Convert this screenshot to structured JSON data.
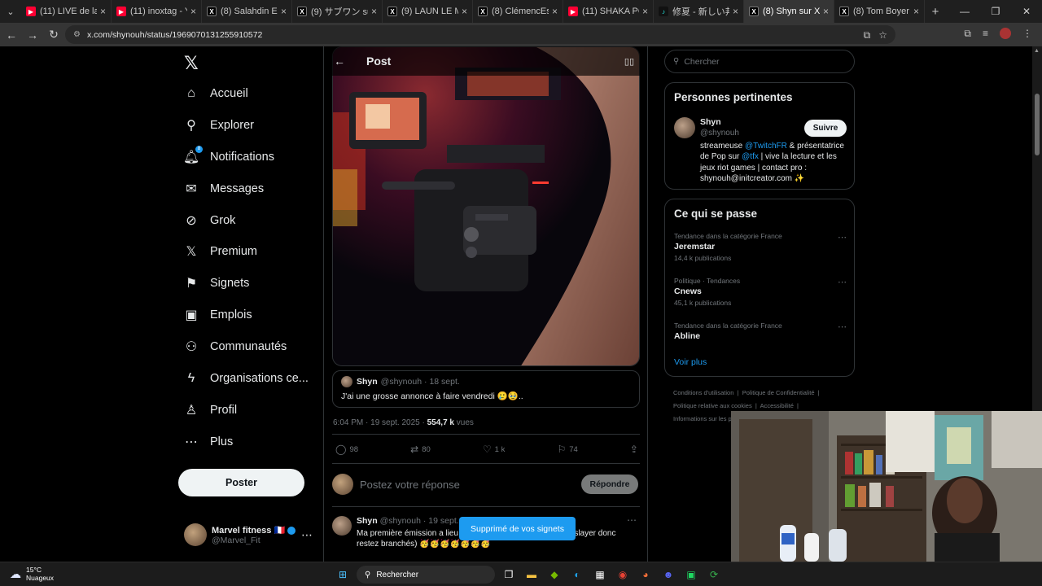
{
  "browser": {
    "tabs": [
      {
        "title": "(11) LIVE de la PA",
        "icon": "youtube-icon",
        "active": false
      },
      {
        "title": "(11) inoxtag - You",
        "icon": "youtube-icon",
        "active": false
      },
      {
        "title": "(8) Salahdin E. su",
        "icon": "x-icon",
        "active": false
      },
      {
        "title": "(9) サブワン sur X :",
        "icon": "x-icon",
        "active": false
      },
      {
        "title": "(9) LAUN LE MAL",
        "icon": "x-icon",
        "active": false
      },
      {
        "title": "(8) ClémencEspoi",
        "icon": "x-icon",
        "active": false
      },
      {
        "title": "(11) SHAKA PONK",
        "icon": "youtube-icon",
        "active": false
      },
      {
        "title": "修夏 - 新しい邦ロッ",
        "icon": "tiktok-icon",
        "active": false
      },
      {
        "title": "(8) Shyn sur X : \"J'",
        "icon": "x-icon",
        "active": true
      },
      {
        "title": "(8) Tom Boyer sur",
        "icon": "x-icon",
        "active": false
      }
    ],
    "url": "x.com/shynouh/status/1969070131255910572"
  },
  "nav": {
    "items": [
      {
        "label": "Accueil",
        "icon": "home-icon"
      },
      {
        "label": "Explorer",
        "icon": "search-icon"
      },
      {
        "label": "Notifications",
        "icon": "bell-icon",
        "badge": "8"
      },
      {
        "label": "Messages",
        "icon": "envelope-icon"
      },
      {
        "label": "Grok",
        "icon": "grok-icon"
      },
      {
        "label": "Premium",
        "icon": "x-icon"
      },
      {
        "label": "Signets",
        "icon": "bookmark-icon"
      },
      {
        "label": "Emplois",
        "icon": "briefcase-icon"
      },
      {
        "label": "Communautés",
        "icon": "people-icon"
      },
      {
        "label": "Organisations ce...",
        "icon": "lightning-icon"
      },
      {
        "label": "Profil",
        "icon": "person-icon"
      },
      {
        "label": "Plus",
        "icon": "more-circle-icon"
      }
    ],
    "post_label": "Poster",
    "account": {
      "name": "Marvel fitness",
      "flag": "🇫🇷",
      "handle": "@Marvel_Fit"
    }
  },
  "post": {
    "header_title": "Post",
    "quote": {
      "name": "Shyn",
      "handle": "@shynouh",
      "date": "· 18 sept.",
      "text": "J'ai une grosse annonce à faire vendredi 🥲🥹.."
    },
    "meta": {
      "time": "6:04 PM · 19 sept. 2025 · ",
      "views": "554,7 k",
      "views_suffix": " vues"
    },
    "actions": {
      "replies": "98",
      "reposts": "80",
      "likes": "1 k",
      "bookmarks": "74"
    },
    "reply_placeholder": "Postez votre réponse",
    "reply_button": "Répondre",
    "reply_tweet": {
      "name": "Shyn",
      "handle": "@shynouh",
      "date": "· 19 sept.",
      "text": "Ma première émission a lieu ... (On va parler du film Démon slayer donc restez branchés) 🥳🥳🥳🥳🥳🥳🥳"
    },
    "toast": "Supprimé de vos signets"
  },
  "right": {
    "search_placeholder": "Chercher",
    "relevant": {
      "title": "Personnes pertinentes",
      "name": "Shyn",
      "handle": "@shynouh",
      "follow": "Suivre",
      "bio_1": "streameuse ",
      "bio_mention1": "@TwitchFR",
      "bio_2": " & présentatrice de Pop sur ",
      "bio_mention2": "@tfx",
      "bio_3": " | vive la lecture et les jeux riot games | contact pro : shynouh@initcreator.com ✨"
    },
    "trends": {
      "title": "Ce qui se passe",
      "items": [
        {
          "context": "Tendance dans la catégorie France",
          "name": "Jeremstar",
          "count": "14,4 k publications"
        },
        {
          "context": "Politique · Tendances",
          "name": "Cnews",
          "count": "45,1 k publications"
        },
        {
          "context": "Tendance dans la catégorie France",
          "name": "Abline",
          "count": ""
        }
      ],
      "show_more": "Voir plus"
    },
    "footer": [
      "Conditions d'utilisation",
      "Politique de Confidentialité",
      "Politique relative aux cookies",
      "Accessibilité",
      "Informations sur les p"
    ]
  },
  "taskbar": {
    "temp": "15°C",
    "weather": "Nuageux",
    "search": "Rechercher"
  },
  "colors": {
    "accent": "#1d9bf0",
    "background": "#000000",
    "border": "#2f3336",
    "muted": "#71767b"
  }
}
